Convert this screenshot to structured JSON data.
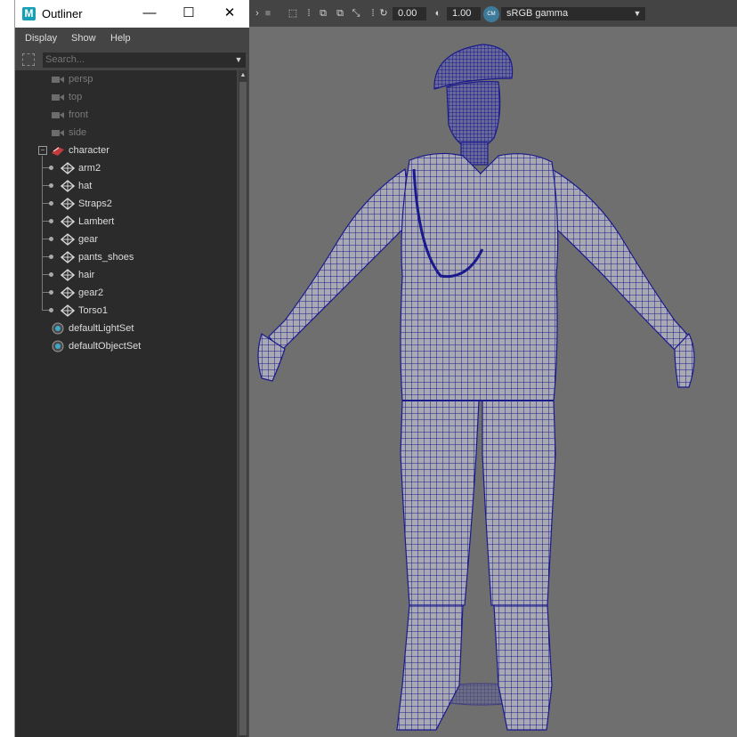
{
  "outliner": {
    "title": "Outliner",
    "logo": "M",
    "controls": {
      "minimize": "—",
      "maximize": "☐",
      "close": "✕"
    },
    "menu": [
      "Display",
      "Show",
      "Help"
    ],
    "search_placeholder": "Search...",
    "items": [
      {
        "label": "persp",
        "icon": "camera-icon",
        "dim": true,
        "indent": 0
      },
      {
        "label": "top",
        "icon": "camera-icon",
        "dim": true,
        "indent": 0
      },
      {
        "label": "front",
        "icon": "camera-icon",
        "dim": true,
        "indent": 0
      },
      {
        "label": "side",
        "icon": "camera-icon",
        "dim": true,
        "indent": 0
      },
      {
        "label": "character",
        "icon": "group-icon",
        "dim": false,
        "indent": 0,
        "expanded": true
      },
      {
        "label": "arm2",
        "icon": "mesh-icon",
        "dim": false,
        "indent": 1
      },
      {
        "label": "hat",
        "icon": "mesh-icon",
        "dim": false,
        "indent": 1
      },
      {
        "label": "Straps2",
        "icon": "mesh-icon",
        "dim": false,
        "indent": 1
      },
      {
        "label": "Lambert",
        "icon": "mesh-icon",
        "dim": false,
        "indent": 1
      },
      {
        "label": "gear",
        "icon": "mesh-icon",
        "dim": false,
        "indent": 1
      },
      {
        "label": "pants_shoes",
        "icon": "mesh-icon",
        "dim": false,
        "indent": 1
      },
      {
        "label": "hair",
        "icon": "mesh-icon",
        "dim": false,
        "indent": 1
      },
      {
        "label": "gear2",
        "icon": "mesh-icon",
        "dim": false,
        "indent": 1
      },
      {
        "label": "Torso1",
        "icon": "mesh-icon",
        "dim": false,
        "indent": 1
      },
      {
        "label": "defaultLightSet",
        "icon": "set-icon",
        "dim": false,
        "indent": 0
      },
      {
        "label": "defaultObjectSet",
        "icon": "set-icon",
        "dim": false,
        "indent": 0
      }
    ]
  },
  "viewport": {
    "exposure": "0.00",
    "gamma": "1.00",
    "color_management_badge": "CM",
    "color_space": "sRGB gamma",
    "wire_color": "#1a1a8c",
    "mesh_color": "#a9a9b4",
    "background": "#6f6f6f"
  }
}
